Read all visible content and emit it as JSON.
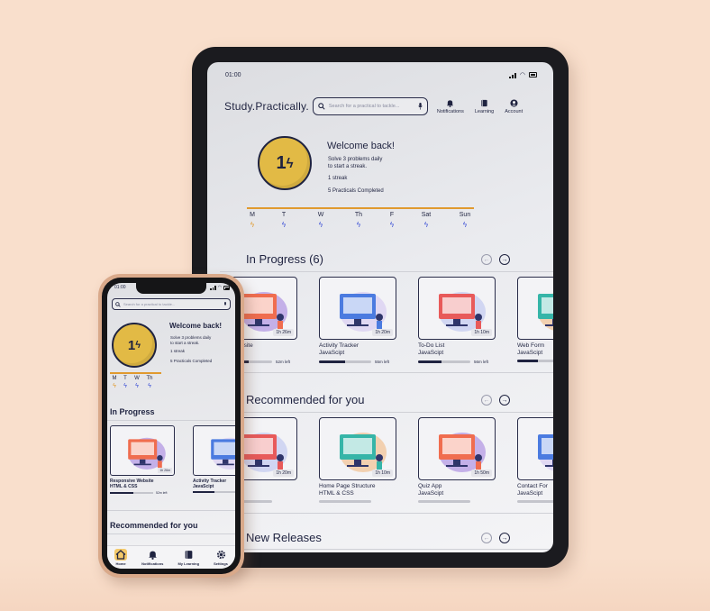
{
  "tablet": {
    "status_time": "01:00",
    "logo": "Study.Practically.",
    "search_placeholder": "Search for a practical to tackle...",
    "nav": [
      {
        "label": "Notifications",
        "icon": "bell-icon"
      },
      {
        "label": "Learning",
        "icon": "book-icon"
      },
      {
        "label": "Account",
        "icon": "account-icon"
      }
    ],
    "welcome": {
      "badge": "1",
      "title": "Welcome back!",
      "line1": "Solve 3 problems daily",
      "line2": "to start a streak.",
      "streak": "1 streak",
      "completed": "5 Practicals Completed"
    },
    "days": [
      "M",
      "T",
      "W",
      "Th",
      "F",
      "Sat",
      "Sun"
    ],
    "sections": {
      "in_progress": "In Progress (6)",
      "recommended": "Recommended for you",
      "new_releases": "New Releases"
    },
    "in_progress_cards": [
      {
        "title": "sive Website",
        "sub": "CSS",
        "duration": "1h 26m",
        "left": "52m left",
        "progress": 0.55
      },
      {
        "title": "Activity Tracker",
        "sub": "JavaScipt",
        "duration": "1h 20m",
        "left": "55m left",
        "progress": 0.5
      },
      {
        "title": "To-Do List",
        "sub": "JavaScipt",
        "duration": "1h 10m",
        "left": "56m left",
        "progress": 0.45
      },
      {
        "title": "Web Form",
        "sub": "JavaScipt",
        "duration": "",
        "left": "",
        "progress": 0.4
      }
    ],
    "recommended_cards": [
      {
        "title": "nager",
        "sub": "pt",
        "duration": "1h 20m"
      },
      {
        "title": "Home Page Structure",
        "sub": "HTML & CSS",
        "duration": "1h 10m"
      },
      {
        "title": "Quiz App",
        "sub": "JavaScipt",
        "duration": "1h 50m"
      },
      {
        "title": "Contact For",
        "sub": "JavaScipt",
        "duration": ""
      }
    ]
  },
  "phone": {
    "status_time": "01:00",
    "search_placeholder": "Search for a practical to tackle...",
    "welcome": {
      "badge": "1",
      "title": "Welcome back!",
      "line1": "Solve 3 problems daily",
      "line2": "to start a streak.",
      "streak": "1 streak",
      "completed": "5 Practicals Completed"
    },
    "days": [
      "M",
      "T",
      "W",
      "Th"
    ],
    "in_progress": "In Progress",
    "recommended": "Recommended for you",
    "cards": [
      {
        "title": "Responsive Website",
        "sub": "HTML & CSS",
        "duration": "1h 26m",
        "left": "52m left",
        "progress": 0.55
      },
      {
        "title": "Activity Tracker",
        "sub": "JavaScipt",
        "duration": "",
        "left": "",
        "progress": 0.5
      }
    ],
    "tabs": [
      {
        "label": "Home",
        "icon": "home-icon"
      },
      {
        "label": "Notifications",
        "icon": "bell-icon"
      },
      {
        "label": "My Learning",
        "icon": "book-icon"
      },
      {
        "label": "Settings",
        "icon": "gear-icon"
      }
    ]
  },
  "colors": {
    "accent": "#e09a2f",
    "badge": "#e2ba45",
    "navy": "#1f2340",
    "background": "#f9dfcc"
  }
}
